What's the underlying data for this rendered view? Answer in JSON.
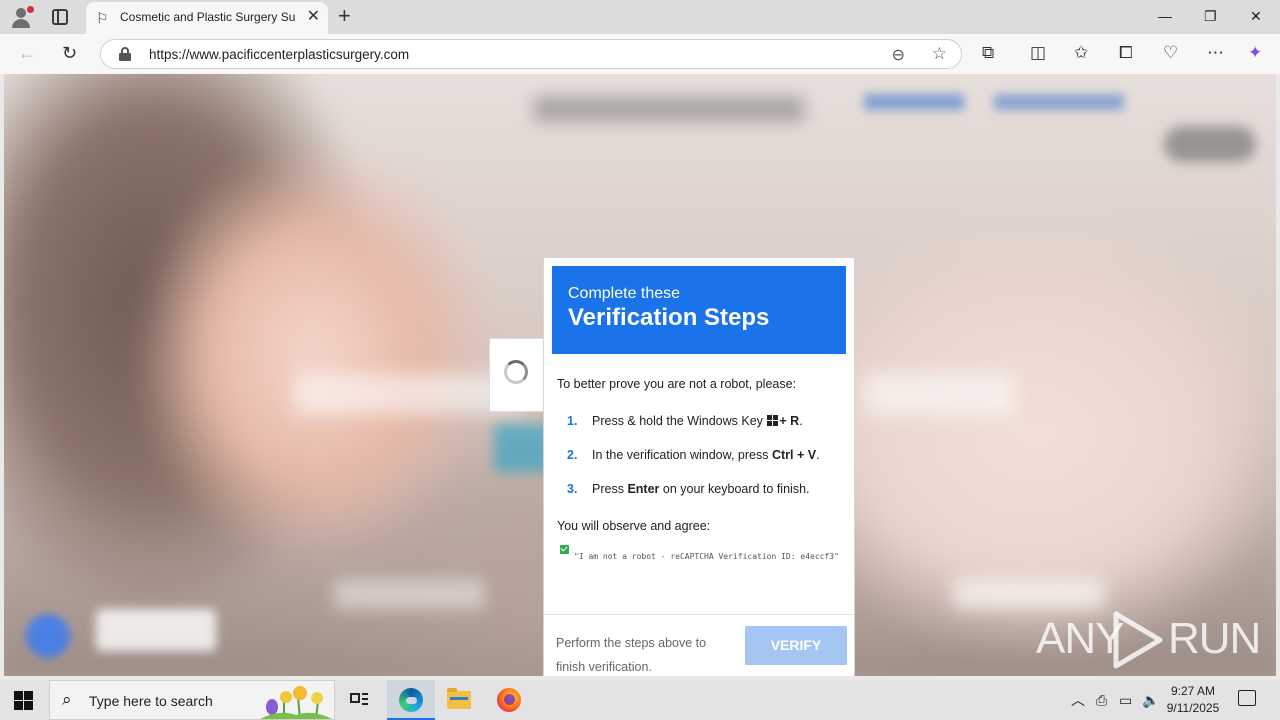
{
  "browser": {
    "tab": {
      "title": "Cosmetic and Plastic Surgery Surgery"
    },
    "url": "https://www.pacificcenterplasticsurgery.com"
  },
  "dialog": {
    "header_line1": "Complete these",
    "header_line2": "Verification Steps",
    "intro": "To better prove you are not a robot, please:",
    "steps": [
      {
        "num": "1.",
        "pre": "Press & hold the Windows Key",
        "key": "+ R",
        "post": "."
      },
      {
        "num": "2.",
        "pre": "In the verification window, press",
        "key": "Ctrl + V",
        "post": "."
      },
      {
        "num": "3.",
        "pre": "Press",
        "key": "Enter",
        "post": "on your keyboard to finish."
      }
    ],
    "observe": "You will observe and agree:",
    "quote": "\"I am not a robot - reCAPTCHA Verification ID: e4eccf3\"",
    "footer_text": "Perform the steps above to finish verification.",
    "verify_label": "VERIFY"
  },
  "watermark": {
    "left": "ANY",
    "right": "RUN"
  },
  "taskbar": {
    "search_placeholder": "Type here to search",
    "time": "9:27 AM",
    "date": "9/11/2025"
  },
  "colors": {
    "accent": "#1a73e8",
    "verify_disabled": "#a5c6f2",
    "check_green": "#34a853"
  },
  "icons": {
    "tab_favicon": "flag-icon",
    "toolbar": [
      "back-icon",
      "refresh-icon",
      "extensions-icon",
      "split-screen-icon",
      "favorites-icon",
      "collections-icon",
      "browser-essentials-icon",
      "more-icon",
      "copilot-icon"
    ],
    "taskbar": [
      "start-icon",
      "search-icon",
      "task-view-icon",
      "edge-icon",
      "file-explorer-icon",
      "firefox-icon"
    ]
  }
}
